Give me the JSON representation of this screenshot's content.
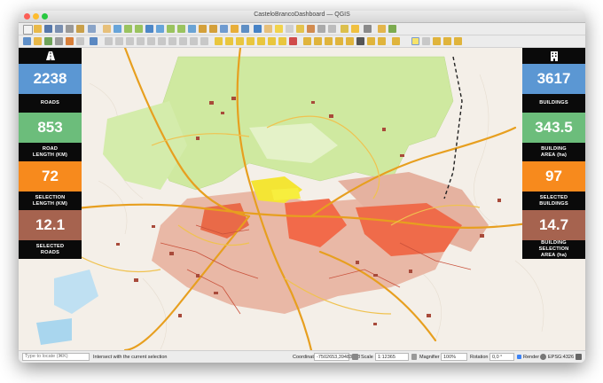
{
  "window": {
    "title": "CasteloBrancoDashboard — QGIS"
  },
  "colors": {
    "blue": "#5b97d3",
    "green": "#6cbd7b",
    "orange": "#f78a1d",
    "brown": "#a6634f",
    "black": "#0a0a0a"
  },
  "left_panel": [
    {
      "value": "2238",
      "label": "ROADS",
      "color": "#5b97d3"
    },
    {
      "value": "853",
      "label": "ROAD\nLENGTH (KM)",
      "color": "#6cbd7b"
    },
    {
      "value": "72",
      "label": "SELECTION\nLENGTH (KM)",
      "color": "#f78a1d"
    },
    {
      "value": "12.1",
      "label": "SELECTED\nROADS",
      "color": "#a6634f"
    }
  ],
  "right_panel": [
    {
      "value": "3617",
      "label": "BUILDINGS",
      "color": "#5b97d3"
    },
    {
      "value": "343.5",
      "label": "BUILDING\nAREA (ha)",
      "color": "#6cbd7b"
    },
    {
      "value": "97",
      "label": "SELECTED\nBUILDINGS",
      "color": "#f78a1d"
    },
    {
      "value": "14.7",
      "label": "BUILDING\nSELECTION\nAREA (ha)",
      "color": "#a6634f"
    }
  ],
  "statusbar": {
    "locator_placeholder": "Type to locate (⌘K)",
    "message": "Intersect with the current selection",
    "coordinate_label": "Coordinate",
    "coordinate_value": "-7502653,39483058",
    "scale_label": "Scale",
    "scale_value": "1:12365",
    "magnifier_label": "Magnifier",
    "magnifier_value": "100%",
    "rotation_label": "Rotation",
    "rotation_value": "0,0 °",
    "render_label": "Render",
    "crs_label": "EPSG:4326"
  }
}
